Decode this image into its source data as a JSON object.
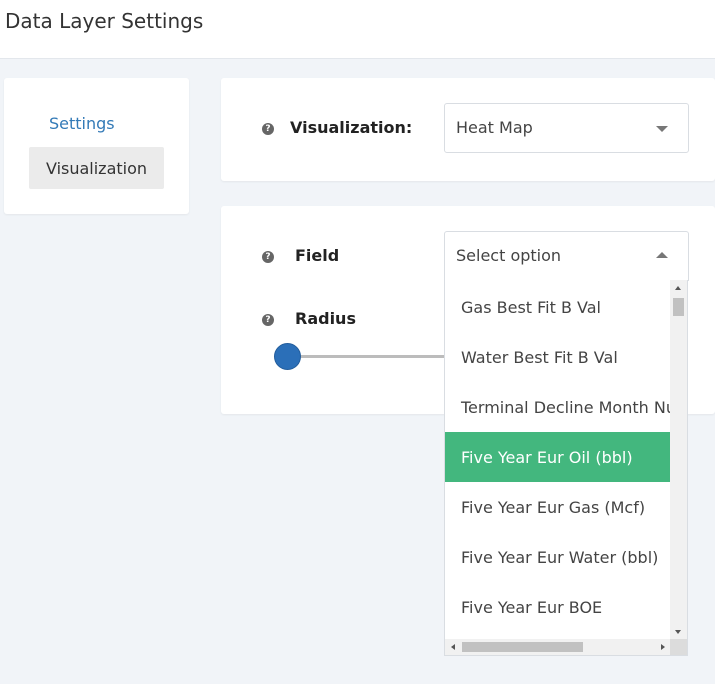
{
  "header": {
    "title": "Data Layer Settings"
  },
  "nav": {
    "items": [
      {
        "label": "Settings",
        "active": false
      },
      {
        "label": "Visualization",
        "active": true
      }
    ]
  },
  "visualization": {
    "label": "Visualization:",
    "help_glyph": "?",
    "selected": "Heat Map"
  },
  "field": {
    "label": "Field",
    "help_glyph": "?",
    "placeholder": "Select option",
    "options": [
      {
        "label": "Gas Best Fit B Val",
        "selected": false
      },
      {
        "label": "Water Best Fit B Val",
        "selected": false
      },
      {
        "label": "Terminal Decline Month Num",
        "selected": false
      },
      {
        "label": "Five Year Eur Oil (bbl)",
        "selected": true
      },
      {
        "label": "Five Year Eur Gas (Mcf)",
        "selected": false
      },
      {
        "label": "Five Year Eur Water (bbl)",
        "selected": false
      },
      {
        "label": "Five Year Eur BOE",
        "selected": false
      }
    ]
  },
  "radius": {
    "label": "Radius",
    "help_glyph": "?"
  },
  "colors": {
    "accent": "#337ab7",
    "selected_option": "#43b77e",
    "slider_thumb": "#2b6fb8",
    "background": "#f1f4f8"
  }
}
